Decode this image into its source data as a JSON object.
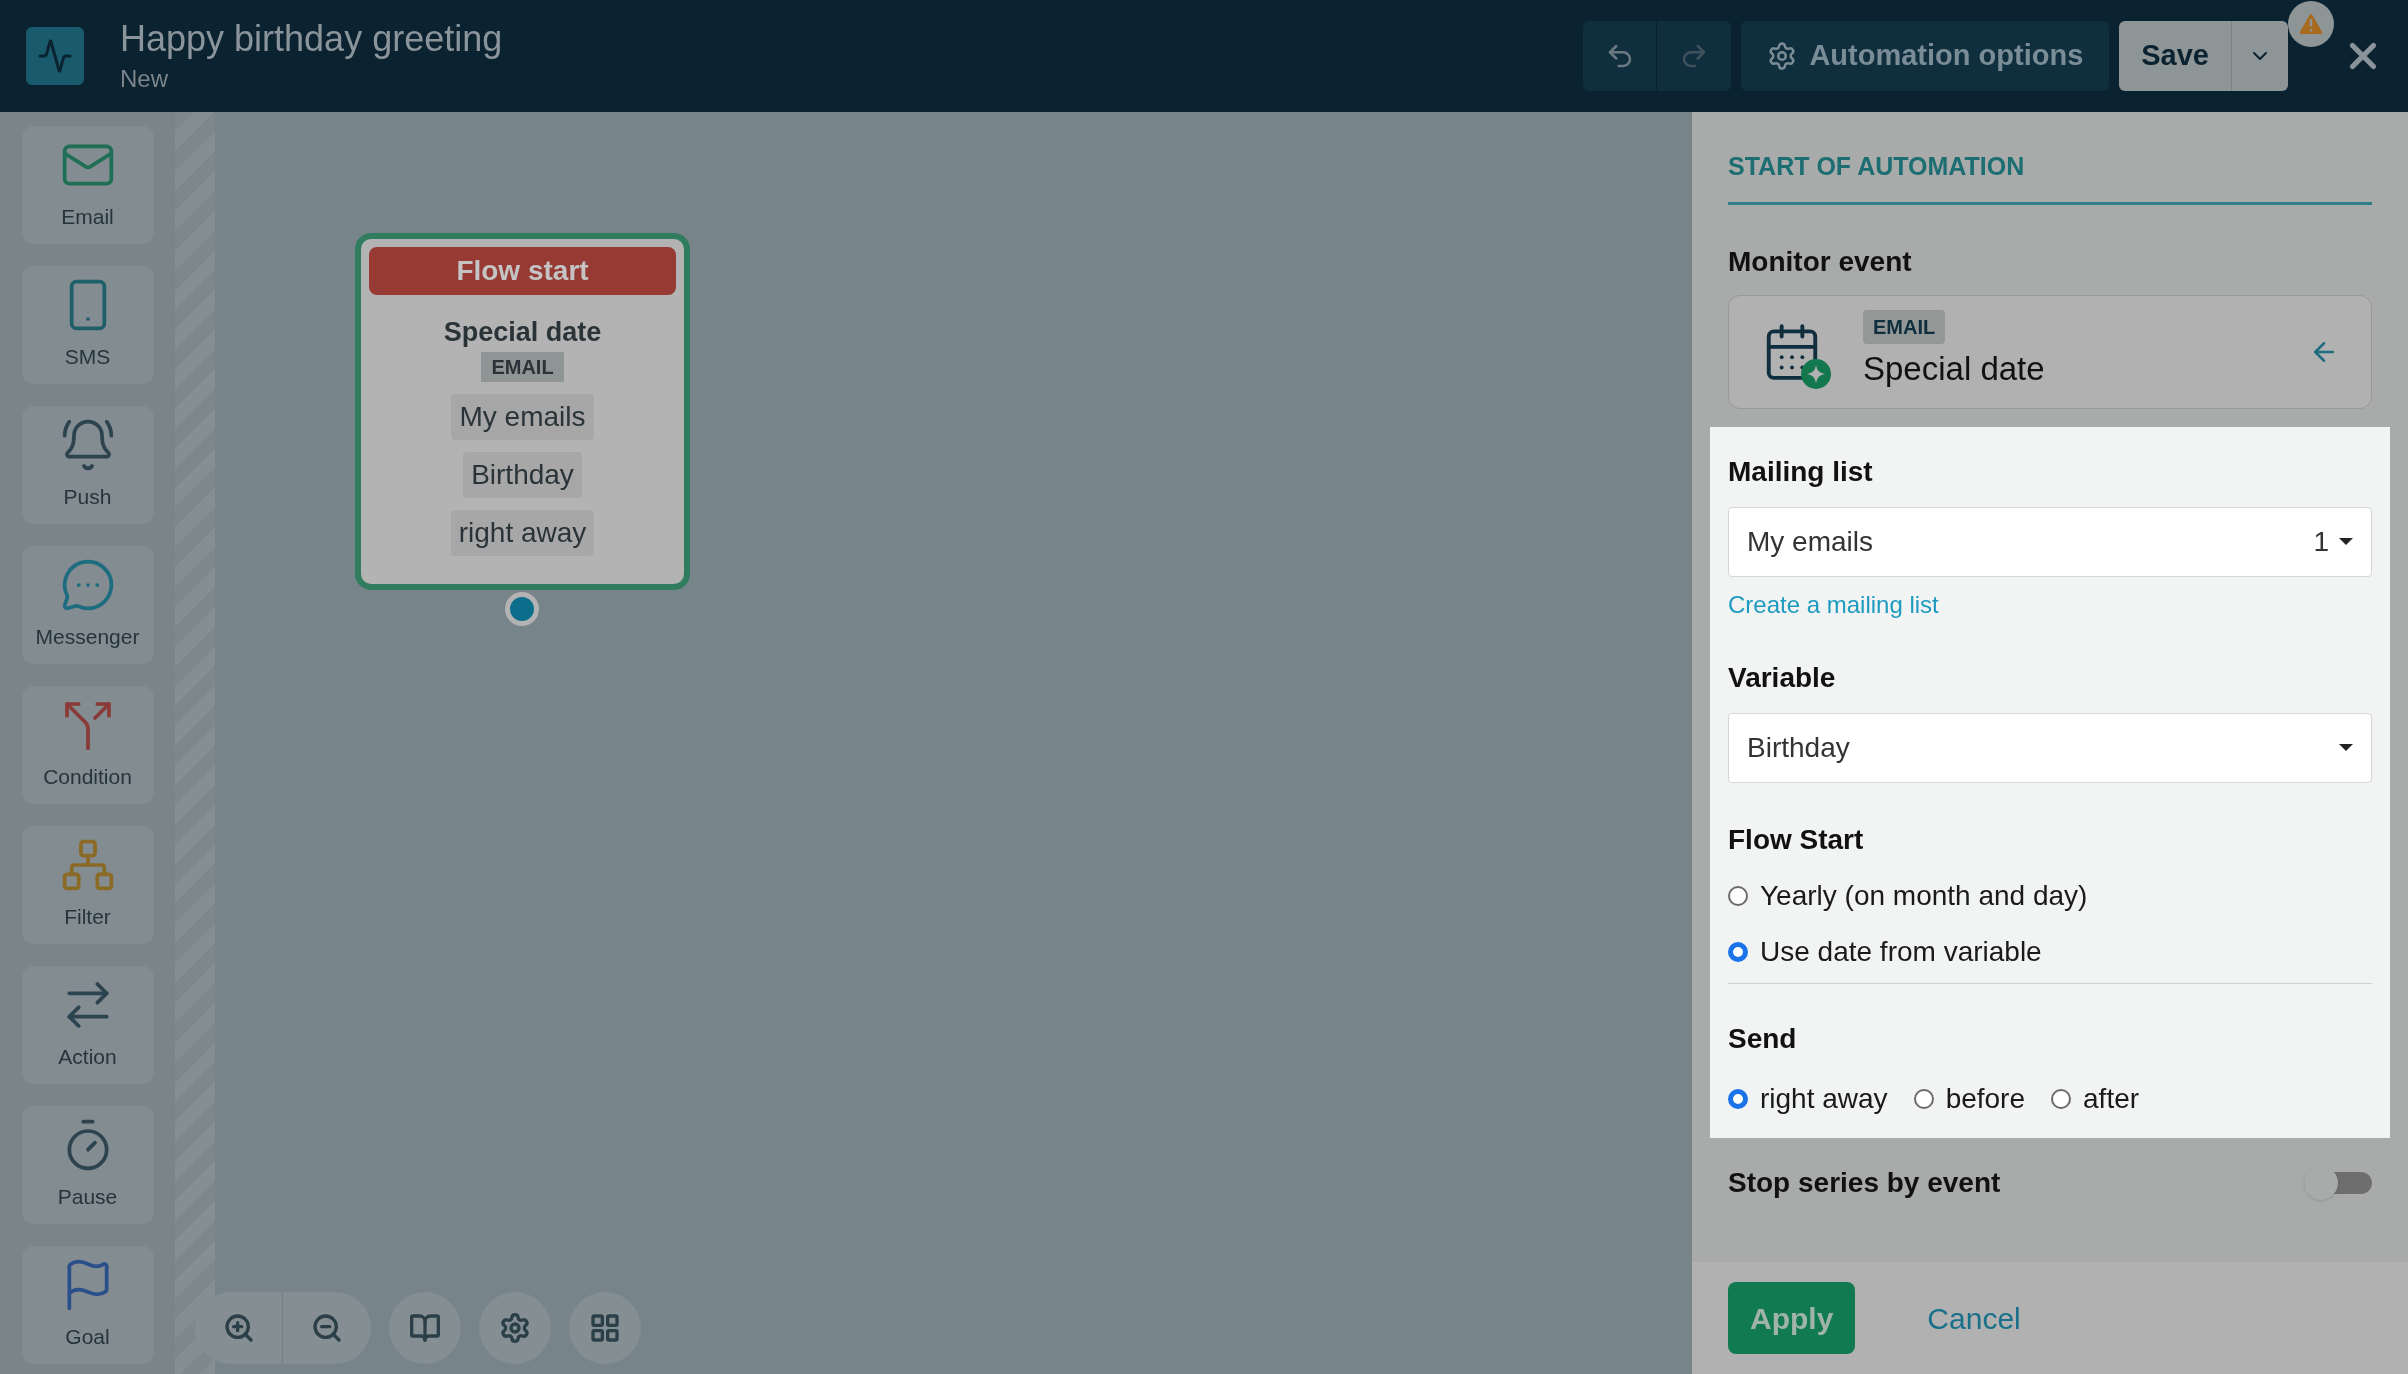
{
  "header": {
    "title": "Happy birthday greeting",
    "subtitle": "New",
    "options_button": "Automation options",
    "save_button": "Save"
  },
  "palette": [
    {
      "label": "Email",
      "kind": "email"
    },
    {
      "label": "SMS",
      "kind": "sms"
    },
    {
      "label": "Push",
      "kind": "push"
    },
    {
      "label": "Messenger",
      "kind": "messenger"
    },
    {
      "label": "Condition",
      "kind": "condition"
    },
    {
      "label": "Filter",
      "kind": "filter"
    },
    {
      "label": "Action",
      "kind": "action"
    },
    {
      "label": "Pause",
      "kind": "pause"
    },
    {
      "label": "Goal",
      "kind": "goal"
    }
  ],
  "flow_node": {
    "header": "Flow start",
    "event": "Special date",
    "channel": "EMAIL",
    "params": [
      "My emails",
      "Birthday",
      "right away"
    ]
  },
  "panel": {
    "section_title": "START OF AUTOMATION",
    "monitor_label": "Monitor event",
    "event": {
      "channel": "EMAIL",
      "name": "Special date"
    },
    "mailing_list": {
      "label": "Mailing list",
      "value": "My emails",
      "count": "1",
      "link": "Create a mailing list"
    },
    "variable": {
      "label": "Variable",
      "value": "Birthday"
    },
    "flow_start": {
      "label": "Flow Start",
      "options": [
        {
          "label": "Yearly (on month and day)",
          "selected": false
        },
        {
          "label": "Use date from variable",
          "selected": true
        }
      ]
    },
    "send": {
      "label": "Send",
      "options": [
        {
          "label": "right away",
          "selected": true
        },
        {
          "label": "before",
          "selected": false
        },
        {
          "label": "after",
          "selected": false
        }
      ]
    },
    "stop_series": {
      "label": "Stop series by event",
      "on": false
    },
    "apply": "Apply",
    "cancel": "Cancel"
  }
}
